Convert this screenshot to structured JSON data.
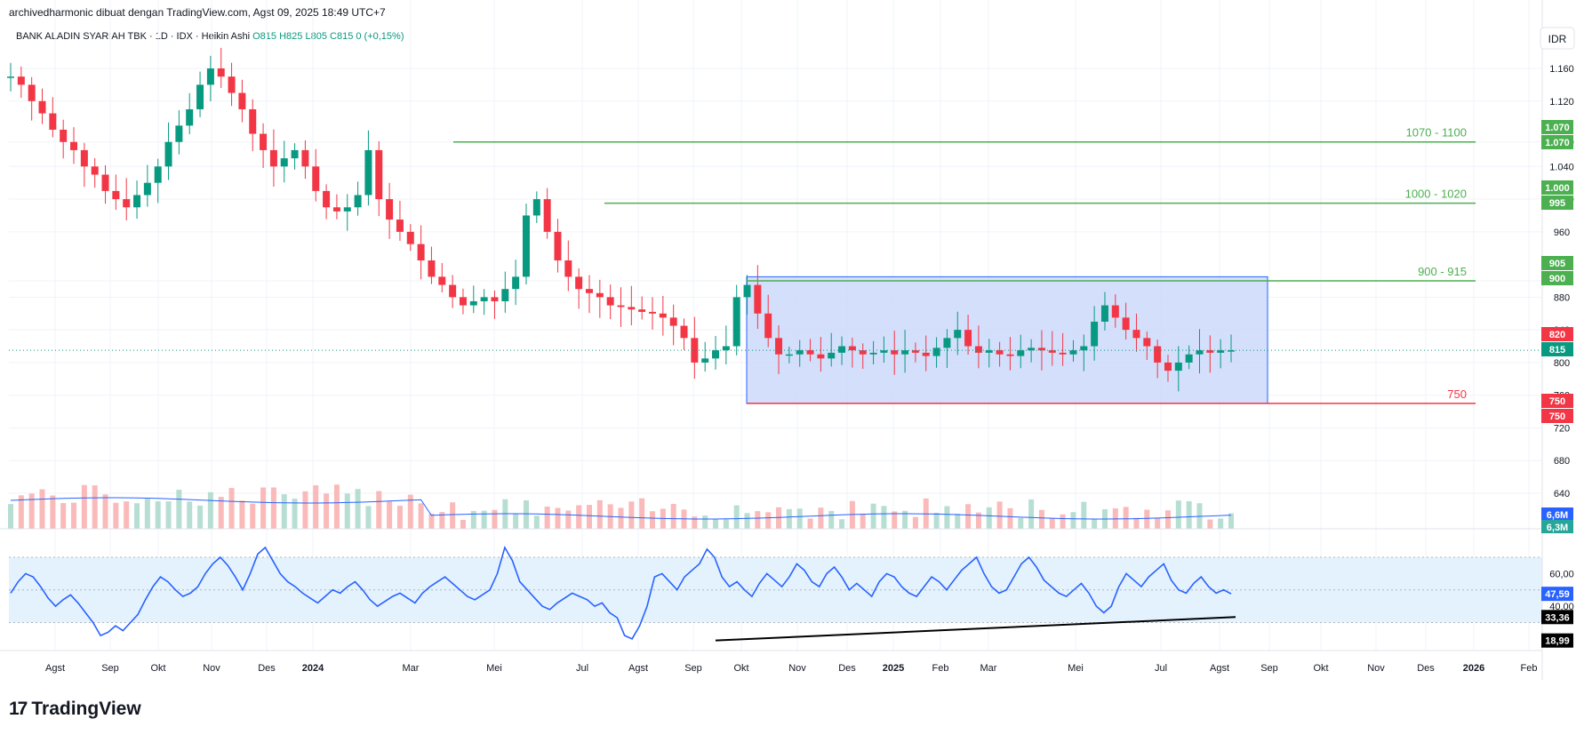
{
  "header": {
    "text": "archivedharmonic dibuat dengan TradingView.com, Agst 09, 2025 18:49 UTC+7"
  },
  "legend": {
    "symbol": "BANK ALADIN SYARIAH TBK · 1D · IDX · Heikin Ashi",
    "o": "O815",
    "h": "H825",
    "l": "L805",
    "c": "C815",
    "change": "0 (+0,15%)"
  },
  "currency_button": "IDR",
  "footer": {
    "brand": "TradingView",
    "mark": "17"
  },
  "colors": {
    "up": "#089981",
    "down": "#f23645",
    "green_line": "#4caf50",
    "red_line": "#f23645",
    "box_fill": "#c9d7fb",
    "box_stroke": "#2962ff",
    "rsi_line": "#2962ff",
    "rsi_band": "#e3f2fd",
    "volume_ma": "#2962ff"
  },
  "chart_data": {
    "type": "candlestick",
    "price_axis": {
      "ticks": [
        "1.160",
        "1.120",
        "1.070",
        "1.040",
        "1.000",
        "960",
        "900",
        "880",
        "840",
        "800",
        "760",
        "720",
        "680",
        "640"
      ],
      "ylim": [
        630,
        1190
      ]
    },
    "x_axis": {
      "ticks": [
        "Agst",
        "Sep",
        "Okt",
        "Nov",
        "Des",
        "2024",
        "Mar",
        "Mei",
        "Jul",
        "Agst",
        "Sep",
        "Okt",
        "Nov",
        "Des",
        "2025",
        "Feb",
        "Mar",
        "Mei",
        "Jul",
        "Agst",
        "Sep",
        "Okt",
        "Nov",
        "Des",
        "2026",
        "Feb"
      ]
    },
    "horizontal_levels": [
      {
        "label": "1070 - 1100",
        "value": 1070,
        "color": "green"
      },
      {
        "label": "1000 - 1020",
        "value": 995,
        "color": "green"
      },
      {
        "label": "900 - 915",
        "value": 900,
        "color": "green"
      },
      {
        "label": "750",
        "value": 750,
        "color": "red"
      }
    ],
    "range_box": {
      "top": 905,
      "bottom": 750
    },
    "price_tags": [
      {
        "text": "1.070",
        "value": 1070,
        "color": "green"
      },
      {
        "text": "1.070",
        "value": 1070,
        "color": "green"
      },
      {
        "text": "1.000",
        "value": 1000,
        "color": "green"
      },
      {
        "text": "995",
        "value": 995,
        "color": "green"
      },
      {
        "text": "905",
        "value": 905,
        "color": "green"
      },
      {
        "text": "900",
        "value": 900,
        "color": "green"
      },
      {
        "text": "820",
        "value": 820,
        "color": "red"
      },
      {
        "text": "815",
        "value": 815,
        "color": "teal"
      },
      {
        "text": "750",
        "value": 750,
        "color": "red"
      },
      {
        "text": "750",
        "value": 750,
        "color": "red"
      }
    ],
    "last_price": 815,
    "volume_tags": [
      "6,6M",
      "6,3M"
    ],
    "rsi": {
      "ticks": [
        "60,00",
        "40,00"
      ],
      "ylim": [
        15,
        82
      ],
      "band": [
        30,
        70
      ],
      "tags": [
        {
          "text": "47,59",
          "value": 47.59,
          "color": "blue"
        },
        {
          "text": "33,36",
          "value": 33.36,
          "color": "black"
        },
        {
          "text": "18,99",
          "value": 18.99,
          "color": "black"
        }
      ],
      "series": [
        48,
        55,
        60,
        58,
        52,
        45,
        40,
        44,
        47,
        42,
        36,
        30,
        22,
        24,
        28,
        25,
        30,
        35,
        44,
        52,
        58,
        55,
        50,
        46,
        48,
        52,
        60,
        66,
        70,
        65,
        58,
        50,
        60,
        72,
        76,
        68,
        60,
        55,
        52,
        48,
        45,
        42,
        46,
        50,
        48,
        52,
        55,
        50,
        44,
        40,
        43,
        46,
        48,
        45,
        42,
        48,
        52,
        55,
        58,
        54,
        50,
        46,
        44,
        47,
        50,
        60,
        76,
        68,
        55,
        50,
        45,
        40,
        38,
        42,
        45,
        48,
        46,
        44,
        40,
        42,
        36,
        33,
        22,
        20,
        28,
        40,
        58,
        60,
        55,
        50,
        58,
        62,
        66,
        75,
        70,
        58,
        52,
        55,
        50,
        46,
        54,
        60,
        56,
        52,
        58,
        66,
        62,
        55,
        52,
        60,
        64,
        58,
        50,
        54,
        50,
        46,
        55,
        60,
        58,
        52,
        48,
        46,
        52,
        58,
        55,
        50,
        56,
        62,
        66,
        70,
        60,
        52,
        48,
        50,
        58,
        66,
        70,
        64,
        56,
        52,
        48,
        46,
        50,
        54,
        48,
        40,
        36,
        40,
        52,
        60,
        56,
        52,
        58,
        62,
        66,
        56,
        50,
        48,
        54,
        58,
        52,
        48,
        50,
        47.59
      ],
      "divergence": {
        "from_value": 19,
        "to_value": 33.36
      }
    },
    "series_summary": {
      "description": "Heikin Ashi daily candles with declining trend from ~1150 to ~800 then sideways range 750-905",
      "close_path": [
        1150,
        1140,
        1120,
        1105,
        1085,
        1070,
        1060,
        1040,
        1030,
        1010,
        1000,
        990,
        1005,
        1020,
        1040,
        1070,
        1090,
        1110,
        1140,
        1160,
        1150,
        1130,
        1110,
        1080,
        1060,
        1040,
        1050,
        1060,
        1040,
        1010,
        990,
        985,
        990,
        1005,
        1060,
        1000,
        975,
        960,
        945,
        925,
        905,
        895,
        880,
        870,
        875,
        880,
        875,
        890,
        905,
        980,
        1000,
        960,
        925,
        905,
        890,
        885,
        880,
        870,
        868,
        865,
        862,
        860,
        855,
        845,
        830,
        800,
        805,
        815,
        820,
        880,
        895,
        860,
        830,
        810,
        810,
        815,
        810,
        805,
        812,
        820,
        815,
        810,
        812,
        815,
        810,
        815,
        812,
        808,
        818,
        830,
        840,
        820,
        812,
        815,
        810,
        808,
        815,
        818,
        815,
        812,
        810,
        815,
        820,
        850,
        870,
        855,
        840,
        830,
        820,
        800,
        790,
        800,
        810,
        815,
        812,
        815,
        815
      ]
    }
  }
}
